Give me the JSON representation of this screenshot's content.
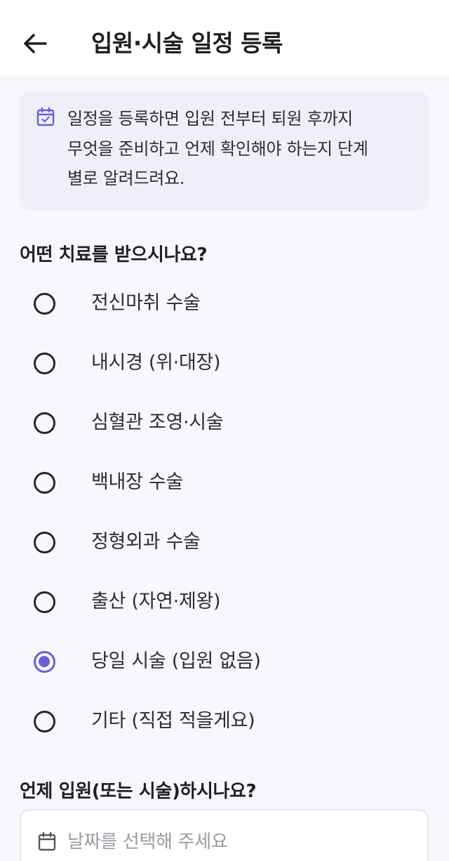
{
  "header": {
    "title": "입원·시술 일정 등록",
    "back_icon": "arrow-left-icon"
  },
  "notice": {
    "icon": "calendar-check-icon",
    "lines": [
      "일정을 등록하면 입원 전부터 퇴원 후까지",
      "무엇을 준비하고 언제 확인해야 하는지 단계",
      "별로 알려드려요."
    ]
  },
  "treatment": {
    "question": "어떤 치료를 받으시나요?",
    "selected_index": 6,
    "options": [
      "전신마취 수술",
      "내시경 (위·대장)",
      "심혈관 조영·시술",
      "백내장 수술",
      "정형외과 수술",
      "출산 (자연·제왕)",
      "당일 시술 (입원 없음)",
      "기타 (직접 적을게요)"
    ]
  },
  "schedule": {
    "question": "언제 입원(또는 시술)하시나요?",
    "date_placeholder": "날짜를 선택해 주세요",
    "icon": "calendar-icon"
  },
  "colors": {
    "accent": "#6a5fd6",
    "notice_bg": "#efeff9",
    "page_bg": "#f8f8fc"
  }
}
